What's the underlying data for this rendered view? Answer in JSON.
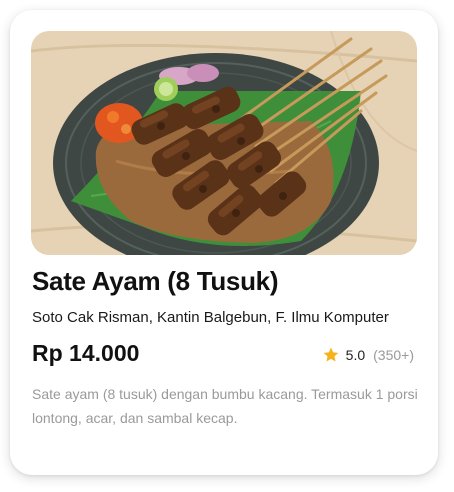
{
  "menu_card": {
    "title": "Sate Ayam (8 Tusuk)",
    "location": "Soto Cak Risman, Kantin Balgebun, F. Ilmu Komputer",
    "price": "Rp 14.000",
    "rating": {
      "score": "5.0",
      "count": "(350+)",
      "icon": "star-icon",
      "star_color": "#F5B21B"
    },
    "description": "Sate ayam (8 tusuk) dengan bumbu kacang. Termasuk 1 porsi lontong, acar, dan sambal kecap.",
    "image": {
      "icon": "food-photo-sate-ayam"
    }
  }
}
